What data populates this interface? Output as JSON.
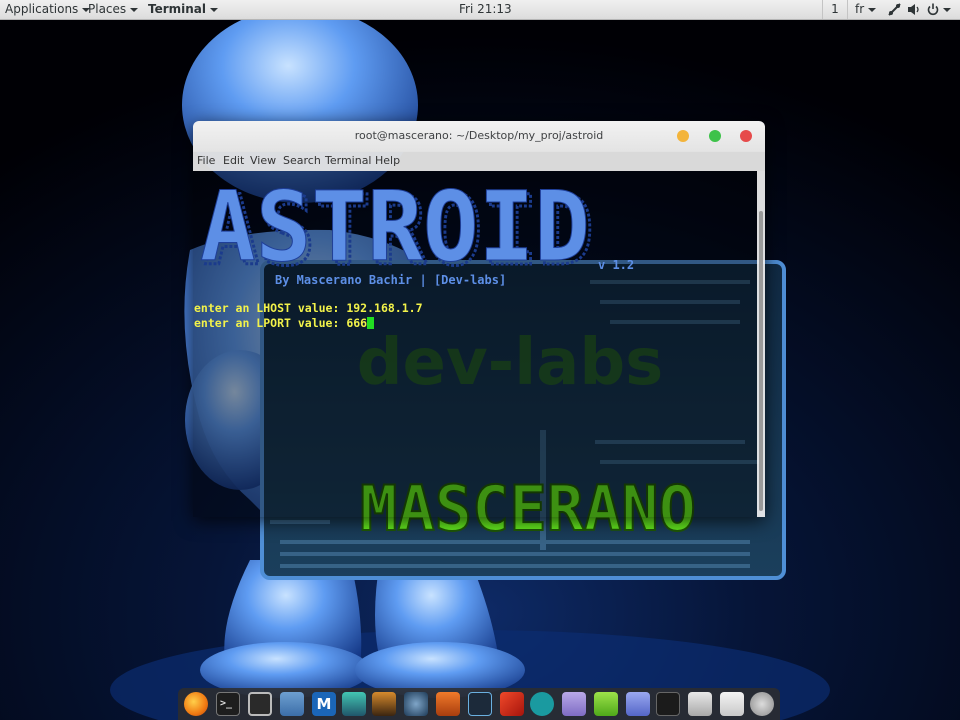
{
  "top_panel": {
    "applications": "Applications",
    "places": "Places",
    "terminal": "Terminal",
    "clock": "Fri 21:13",
    "workspace": "1",
    "keyboard_layout": "fr"
  },
  "window": {
    "title": "root@mascerano: ~/Desktop/my_proj/astroid",
    "menu": [
      "File",
      "Edit",
      "View",
      "Search",
      "Terminal",
      "Help"
    ]
  },
  "terminal": {
    "banner": "ASTROID",
    "version": "v 1.2",
    "byline": "By Mascerano Bachir | [Dev-labs]",
    "lhost_prompt": "enter an LHOST value: ",
    "lhost_value": "192.168.1.7",
    "lport_prompt": "enter an LPORT value: ",
    "lport_value": "666"
  },
  "wallpaper_text": {
    "devlabs": "dev-labs",
    "mascerano": "MASCERANO"
  },
  "dock": {
    "icons": [
      "firefox-icon",
      "terminal-icon",
      "files-browser-icon",
      "folder-icon",
      "metasploit-icon",
      "armitage-icon",
      "burpsuite-icon",
      "maltego-icon",
      "beef-icon",
      "kali-tool-icon",
      "faraday-icon",
      "arduino-icon",
      "text-editor-icon",
      "notes-icon",
      "install-icon",
      "system-monitor-icon",
      "disk-icon",
      "settings-toggle-icon",
      "rocket-icon"
    ]
  },
  "colors": {
    "banner_blue": "#5d8fe6",
    "prompt_yellow": "#f2f24a",
    "cursor_green": "#22dd22",
    "wallpaper_green": "#63e81e"
  }
}
